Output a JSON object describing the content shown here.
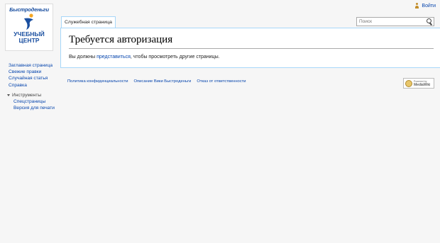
{
  "topbar": {
    "login_label": "Войти"
  },
  "logo": {
    "site_name": "Быстроденьги",
    "line1": "УЧЕБНЫЙ",
    "line2": "ЦЕНТР"
  },
  "sidebar": {
    "items": [
      {
        "label": "Заглавная страница"
      },
      {
        "label": "Свежие правки"
      },
      {
        "label": "Случайная статья"
      },
      {
        "label": "Справка"
      }
    ]
  },
  "tools": {
    "heading": "Инструменты",
    "items": [
      {
        "label": "Спецстраницы"
      },
      {
        "label": "Версия для печати"
      }
    ]
  },
  "tabs": [
    {
      "label": "Служебная страница"
    }
  ],
  "search": {
    "placeholder": "Поиск"
  },
  "page": {
    "title": "Требуется авторизация",
    "message_prefix": "Вы должны ",
    "message_link": "представиться",
    "message_suffix": ", чтобы просмотреть другие страницы."
  },
  "footer": {
    "links": [
      {
        "label": "Политика конфиденциальности"
      },
      {
        "label": "Описание Вики Быстроденьги"
      },
      {
        "label": "Отказ от ответственности"
      }
    ]
  },
  "badge": {
    "powered": "Powered by",
    "name": "MediaWiki"
  },
  "colors": {
    "link": "#0645ad",
    "tab_border": "#a7d7f9",
    "logo_blue": "#1a4fa0"
  },
  "icons": [
    "user-icon",
    "search-icon",
    "collapse-triangle-icon",
    "mediawiki-logo-icon"
  ]
}
